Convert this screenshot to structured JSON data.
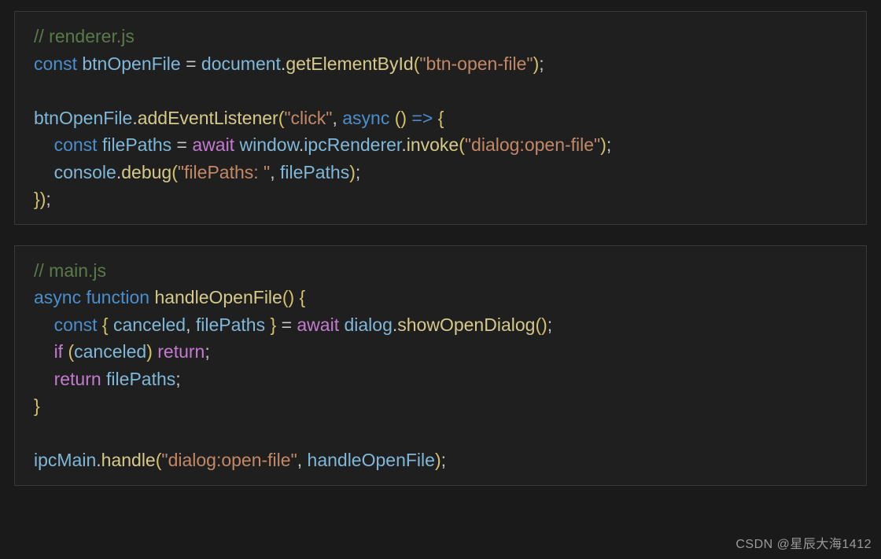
{
  "blocks": {
    "renderer": {
      "comment": "// renderer.js",
      "kw_const1": "const",
      "var_btn": "btnOpenFile",
      "eq1": " = ",
      "obj_document": "document",
      "dot1": ".",
      "fn_getElById": "getElementById",
      "p_open1": "(",
      "str_btnOpenFile": "\"btn-open-file\"",
      "p_close1": ")",
      "semi1": ";",
      "var_btn2": "btnOpenFile",
      "dot2": ".",
      "fn_addEvt": "addEventListener",
      "p_open2": "(",
      "str_click": "\"click\"",
      "comma1": ", ",
      "kw_async": "async",
      "space1": " ",
      "p_open3": "()",
      "arrow": " => ",
      "brace_open1": "{",
      "indent1": "    ",
      "kw_const2": "const",
      "var_filePaths": "filePaths",
      "eq2": " = ",
      "kw_await": "await",
      "obj_window": "window",
      "dot3": ".",
      "obj_ipcRenderer": "ipcRenderer",
      "dot4": ".",
      "fn_invoke": "invoke",
      "p_open4": "(",
      "str_dialogOpen": "\"dialog:open-file\"",
      "p_close4": ")",
      "semi2": ";",
      "indent2": "    ",
      "obj_console": "console",
      "dot5": ".",
      "fn_debug": "debug",
      "p_open5": "(",
      "str_filePaths": "\"filePaths: \"",
      "comma2": ", ",
      "var_filePaths2": "filePaths",
      "p_close5": ")",
      "semi3": ";",
      "brace_close1": "}",
      "p_close2": ")",
      "semi4": ";"
    },
    "main": {
      "comment": "// main.js",
      "kw_async": "async",
      "kw_function": "function",
      "fn_handleOpenFile": "handleOpenFile",
      "p_open1": "()",
      "brace_open1": " {",
      "indent1": "    ",
      "kw_const": "const",
      "brace_open2": " { ",
      "var_canceled": "canceled",
      "comma1": ", ",
      "var_filePaths": "filePaths",
      "brace_close2": " } ",
      "eq": "= ",
      "kw_await": "await",
      "obj_dialog": "dialog",
      "dot1": ".",
      "fn_showOpen": "showOpenDialog",
      "p_open2": "()",
      "semi1": ";",
      "indent2": "    ",
      "kw_if": "if",
      "p_open3": " (",
      "var_canceled2": "canceled",
      "p_close3": ") ",
      "kw_return1": "return",
      "semi2": ";",
      "indent3": "    ",
      "kw_return2": "return",
      "var_filePaths2": "filePaths",
      "semi3": ";",
      "brace_close1": "}",
      "obj_ipcMain": "ipcMain",
      "dot2": ".",
      "fn_handle": "handle",
      "p_open4": "(",
      "str_dialogOpen": "\"dialog:open-file\"",
      "comma2": ", ",
      "var_handleOpenFile": "handleOpenFile",
      "p_close4": ")",
      "semi4": ";"
    }
  },
  "watermark": "CSDN @星辰大海1412"
}
